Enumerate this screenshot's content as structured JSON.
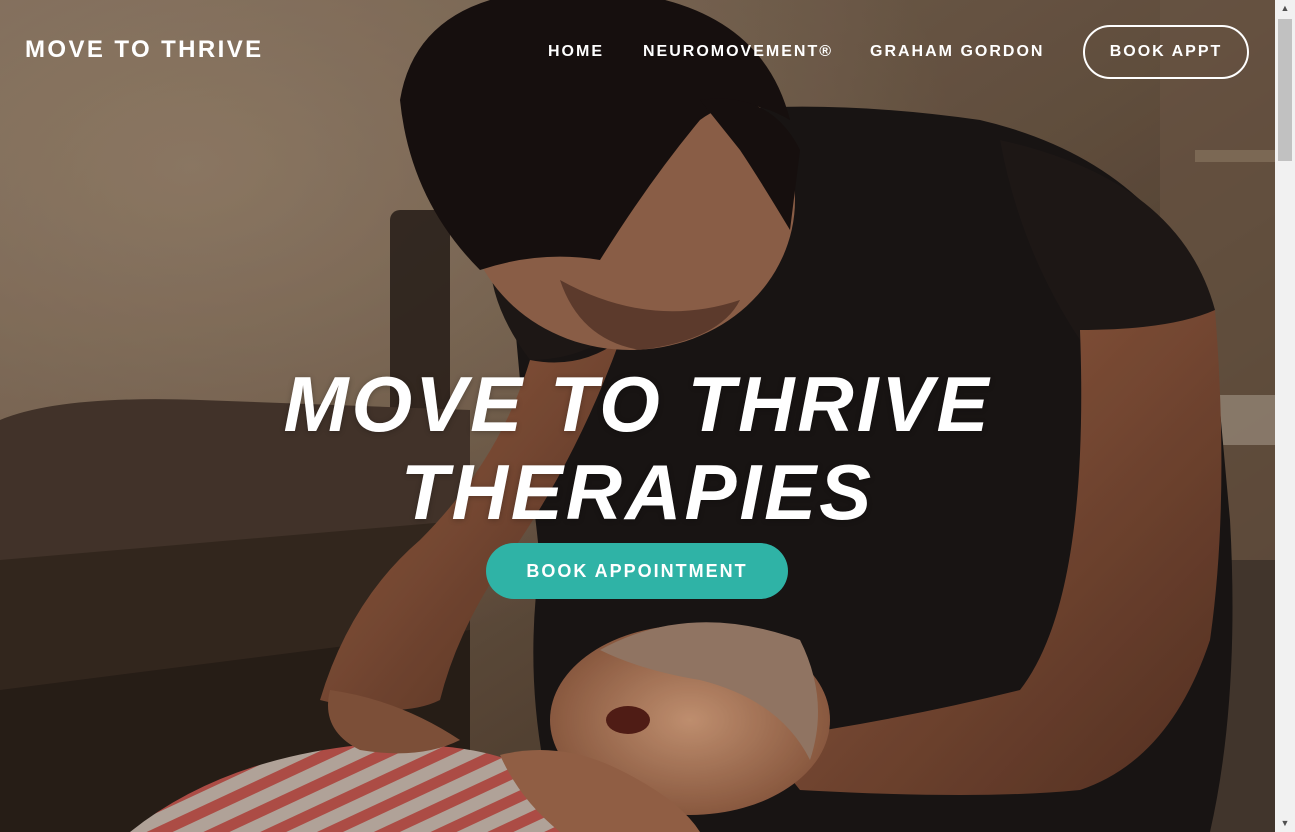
{
  "header": {
    "site_title": "MOVE TO THRIVE",
    "nav": {
      "home": "HOME",
      "neuromovement": "NEUROMOVEMENT®",
      "graham": "GRAHAM GORDON"
    },
    "book_appt": "BOOK APPT"
  },
  "hero": {
    "headline_line1": "MOVE TO THRIVE",
    "headline_line2": "THERAPIES",
    "cta_label": "BOOK APPOINTMENT",
    "cta_color": "#2fb3a6",
    "image_icon": "man-with-child-photo"
  },
  "scrollbar": {
    "up_icon": "triangle-up-icon",
    "down_icon": "triangle-down-icon"
  }
}
